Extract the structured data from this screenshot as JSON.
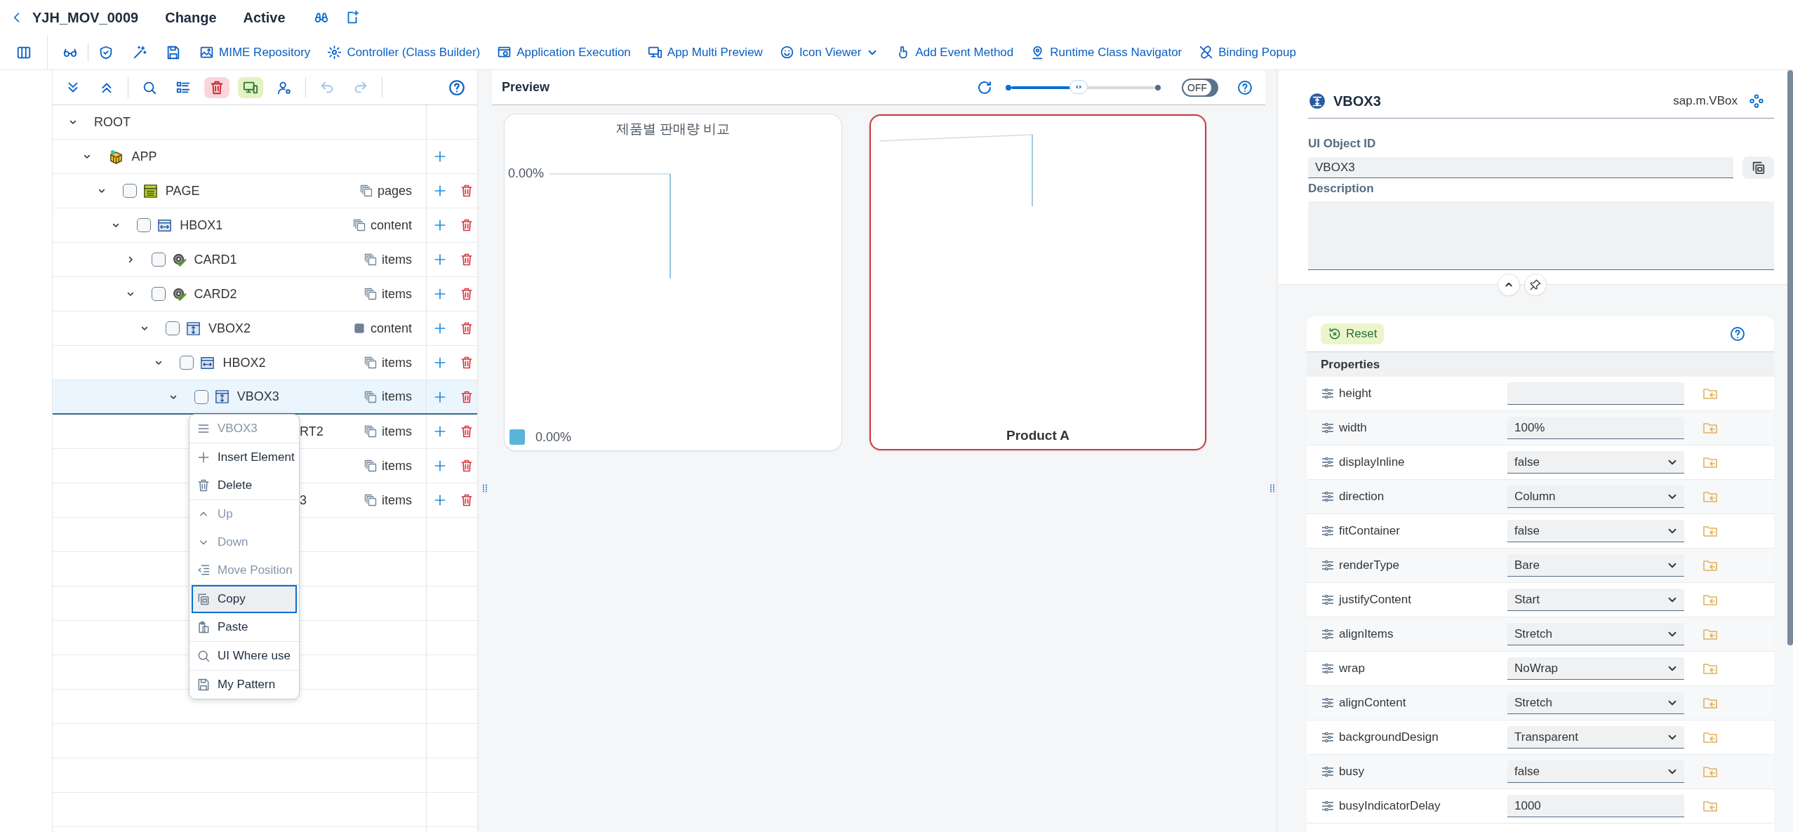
{
  "header": {
    "title": "YJH_MOV_0009",
    "mode": "Change",
    "status": "Active"
  },
  "toolbar": [
    {
      "kind": "mime",
      "label": "MIME Repository",
      "dropdown": false
    },
    {
      "kind": "controller",
      "label": "Controller (Class Builder)",
      "dropdown": false
    },
    {
      "kind": "execution",
      "label": "Application Execution",
      "dropdown": false
    },
    {
      "kind": "multi-preview",
      "label": "App Multi Preview",
      "dropdown": false
    },
    {
      "kind": "icon-viewer",
      "label": "Icon Viewer",
      "dropdown": true
    },
    {
      "kind": "event",
      "label": "Add Event Method",
      "dropdown": false
    },
    {
      "kind": "navigator",
      "label": "Runtime Class Navigator",
      "dropdown": false
    },
    {
      "kind": "binding",
      "label": "Binding Popup",
      "dropdown": false
    }
  ],
  "tree_toolbar": {
    "undo": {
      "disabled": true
    },
    "redo": {
      "disabled": true
    }
  },
  "tree": {
    "rows": [
      {
        "label": "ROOT",
        "expanded": true,
        "selected": false,
        "covered": false,
        "can_add": false,
        "can_delete": false,
        "children": [
          {
            "label": "APP",
            "kind": "app",
            "expanded": true,
            "selected": false,
            "covered": false,
            "can_add": true,
            "can_delete": false,
            "children": [
              {
                "label": "PAGE",
                "kind": "page",
                "expanded": true,
                "checked": false,
                "selected": false,
                "covered": false,
                "binding": {
                  "label": "pages",
                  "kind": "aggregation"
                },
                "can_add": true,
                "can_delete": true,
                "children": [
                  {
                    "label": "HBOX1",
                    "kind": "hbox",
                    "expanded": true,
                    "checked": false,
                    "selected": false,
                    "covered": false,
                    "binding": {
                      "label": "content",
                      "kind": "aggregation"
                    },
                    "can_add": true,
                    "can_delete": true,
                    "children": [
                      {
                        "label": "CARD1",
                        "kind": "card",
                        "expanded": false,
                        "checked": false,
                        "selected": false,
                        "covered": false,
                        "binding": {
                          "label": "items",
                          "kind": "aggregation"
                        },
                        "can_add": true,
                        "can_delete": true
                      },
                      {
                        "label": "CARD2",
                        "kind": "card",
                        "expanded": true,
                        "checked": false,
                        "selected": false,
                        "covered": false,
                        "binding": {
                          "label": "items",
                          "kind": "aggregation"
                        },
                        "can_add": true,
                        "can_delete": true,
                        "children": [
                          {
                            "label": "VBOX2",
                            "kind": "vbox",
                            "expanded": true,
                            "checked": false,
                            "selected": false,
                            "covered": false,
                            "binding": {
                              "label": "content",
                              "kind": "single"
                            },
                            "can_add": true,
                            "can_delete": true,
                            "children": [
                              {
                                "label": "HBOX2",
                                "kind": "hbox",
                                "expanded": true,
                                "checked": false,
                                "selected": false,
                                "covered": false,
                                "binding": {
                                  "label": "items",
                                  "kind": "aggregation"
                                },
                                "can_add": true,
                                "can_delete": true,
                                "children": [
                                  {
                                    "label": "VBOX3",
                                    "kind": "vbox",
                                    "expanded": true,
                                    "checked": false,
                                    "selected": true,
                                    "covered": false,
                                    "binding": {
                                      "label": "items",
                                      "kind": "aggregation"
                                    },
                                    "can_add": true,
                                    "can_delete": true,
                                    "children": [
                                      {
                                        "label": "RT2",
                                        "selected": false,
                                        "covered": true,
                                        "binding": {
                                          "label": "items",
                                          "kind": "aggregation"
                                        },
                                        "can_add": true,
                                        "can_delete": true
                                      },
                                      {
                                        "selected": false,
                                        "covered": true,
                                        "binding": {
                                          "label": "items",
                                          "kind": "aggregation"
                                        },
                                        "can_add": true,
                                        "can_delete": true,
                                        "children": [
                                          {
                                            "label": "3",
                                            "selected": false,
                                            "covered": true,
                                            "binding": {
                                              "label": "items",
                                              "kind": "aggregation"
                                            },
                                            "can_add": true,
                                            "can_delete": true
                                          }
                                        ]
                                      }
                                    ]
                                  }
                                ]
                              }
                            ]
                          }
                        ]
                      }
                    ]
                  }
                ]
              }
            ]
          }
        ]
      }
    ]
  },
  "context_menu": {
    "groups": [
      {
        "items": [
          {
            "kind": "header",
            "label": "VBOX3",
            "disabled": true,
            "selected": false
          }
        ]
      },
      {
        "items": [
          {
            "kind": "insert",
            "label": "Insert Element",
            "disabled": false,
            "selected": false
          },
          {
            "kind": "delete",
            "label": "Delete",
            "disabled": false,
            "selected": false
          }
        ]
      },
      {
        "items": [
          {
            "kind": "up",
            "label": "Up",
            "disabled": true,
            "selected": false
          },
          {
            "kind": "down",
            "label": "Down",
            "disabled": true,
            "selected": false
          },
          {
            "kind": "move",
            "label": "Move Position",
            "disabled": true,
            "selected": false
          }
        ]
      },
      {
        "items": [
          {
            "kind": "copy",
            "label": "Copy",
            "disabled": false,
            "selected": true
          },
          {
            "kind": "paste",
            "label": "Paste",
            "disabled": false,
            "selected": false
          }
        ]
      },
      {
        "items": [
          {
            "kind": "where-used",
            "label": "UI Where use",
            "disabled": false,
            "selected": false
          }
        ]
      },
      {
        "items": [
          {
            "kind": "pattern",
            "label": "My Pattern",
            "disabled": false,
            "selected": false
          }
        ]
      }
    ]
  },
  "preview": {
    "title": "Preview",
    "zoom": {
      "level": 0.47
    },
    "live_switch": {
      "label": "OFF",
      "on": false
    },
    "cards": [
      {
        "kind": "legend-chart",
        "title": "제품별 판매량 비교",
        "axis_label": "0.00%",
        "legend_label": "0.00%",
        "highlighted": false
      },
      {
        "kind": "category-chart",
        "category_label": "Product A",
        "highlighted": true
      }
    ]
  },
  "inspector": {
    "object": {
      "name": "VBOX3",
      "class": "sap.m.VBox"
    },
    "id_field": {
      "label": "UI Object ID",
      "value": "VBOX3"
    },
    "description": {
      "label": "Description"
    },
    "reset_label": "Reset",
    "section_title": "Properties",
    "properties": [
      {
        "name": "height",
        "kind": "input"
      },
      {
        "name": "width",
        "kind": "input",
        "value": "100%"
      },
      {
        "name": "displayInline",
        "kind": "select",
        "value": "false"
      },
      {
        "name": "direction",
        "kind": "select",
        "value": "Column"
      },
      {
        "name": "fitContainer",
        "kind": "select",
        "value": "false"
      },
      {
        "name": "renderType",
        "kind": "select",
        "value": "Bare"
      },
      {
        "name": "justifyContent",
        "kind": "select",
        "value": "Start"
      },
      {
        "name": "alignItems",
        "kind": "select",
        "value": "Stretch"
      },
      {
        "name": "wrap",
        "kind": "select",
        "value": "NoWrap"
      },
      {
        "name": "alignContent",
        "kind": "select",
        "value": "Stretch"
      },
      {
        "name": "backgroundDesign",
        "kind": "select",
        "value": "Transparent"
      },
      {
        "name": "busy",
        "kind": "select",
        "value": "false"
      },
      {
        "name": "busyIndicatorDelay",
        "kind": "input",
        "value": "1000"
      }
    ]
  }
}
